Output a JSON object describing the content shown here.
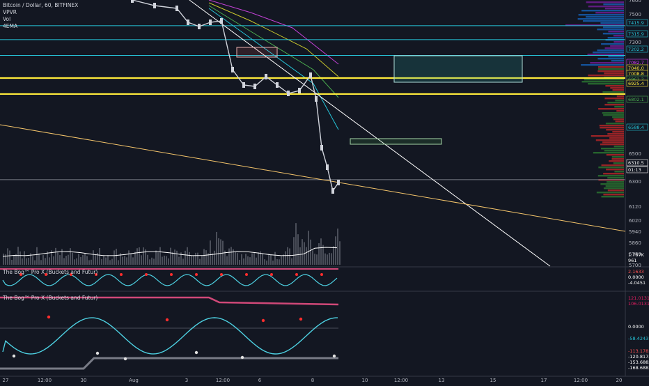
{
  "legend": {
    "symbol": "Bitcoin / Dollar, 60, BITFINEX",
    "ind1": "VPVR",
    "ind2": "Vol",
    "ind3": "4EMA"
  },
  "osc1": {
    "label": "The Bog™ Pro X (Buckets and Futur)"
  },
  "osc2": {
    "label": "The Bog™ Pro X (Buckets and Futur)"
  },
  "colors": {
    "background": "#131722",
    "candle": "#d1d4dc",
    "yellow_level": "#ffeb3b",
    "cyan_level": "#26c6da",
    "trendline": "#ffffff",
    "support_trend": "#f5c56b",
    "ema_magenta": "#c341d6",
    "ema_yellow": "#c8c62c",
    "ema_green": "#4caf50",
    "ema_cyan": "#26c6da",
    "osc_wave": "#4dd0e1",
    "osc_dot_red": "#ff2d2d",
    "osc_dot_white": "#e0e0e0",
    "osc_bar": "#d04878"
  },
  "chart_data": {
    "type": "candlestick",
    "symbol": "Bitcoin / Dollar",
    "timeframe": "60",
    "exchange": "BITFINEX",
    "y_range": [
      5700,
      7600
    ],
    "y_ticks": [
      7600,
      7500,
      7300,
      7100,
      6900,
      6700,
      6500,
      6300,
      6120,
      6020,
      5940,
      5860,
      5780,
      5700
    ],
    "x_ticks": [
      "27",
      "12:00",
      "30",
      "Aug",
      "3",
      "12:00",
      "6",
      "8",
      "10",
      "12:00",
      "13",
      "15",
      "17",
      "12:00",
      "20"
    ],
    "price_series": [
      {
        "t": 0,
        "p": 7600
      },
      {
        "t": 4,
        "p": 7560
      },
      {
        "t": 8,
        "p": 7540
      },
      {
        "t": 10,
        "p": 7440
      },
      {
        "t": 12,
        "p": 7410
      },
      {
        "t": 14,
        "p": 7440
      },
      {
        "t": 16,
        "p": 7450
      },
      {
        "t": 18,
        "p": 7100
      },
      {
        "t": 20,
        "p": 6990
      },
      {
        "t": 22,
        "p": 6980
      },
      {
        "t": 24,
        "p": 7050
      },
      {
        "t": 26,
        "p": 6990
      },
      {
        "t": 28,
        "p": 6930
      },
      {
        "t": 30,
        "p": 6950
      },
      {
        "t": 32,
        "p": 7060
      },
      {
        "t": 33,
        "p": 6890
      },
      {
        "t": 34,
        "p": 6540
      },
      {
        "t": 35,
        "p": 6400
      },
      {
        "t": 36,
        "p": 6230
      },
      {
        "t": 37,
        "p": 6290
      }
    ],
    "horizontal_levels": [
      {
        "price": 7415.9,
        "color": "#26c6da"
      },
      {
        "price": 7315.9,
        "color": "#26c6da"
      },
      {
        "price": 7202.2,
        "color": "#26c6da"
      },
      {
        "price": 7040.0,
        "color": "#ffeb3b"
      },
      {
        "price": 6925.4,
        "color": "#ffeb3b"
      },
      {
        "price": 6310.5,
        "color": "#787b86"
      }
    ],
    "price_labels": [
      {
        "value": "7415.9",
        "color": "#26c6da"
      },
      {
        "value": "7315.9",
        "color": "#26c6da"
      },
      {
        "value": "7202.2",
        "color": "#26c6da"
      },
      {
        "value": "7082.7",
        "color": "#e040fb"
      },
      {
        "value": "7040.0",
        "color": "#ffeb3b"
      },
      {
        "value": "7008.8",
        "color": "#ffeb3b"
      },
      {
        "value": "6962.2",
        "color": "#4caf50"
      },
      {
        "value": "6925.4",
        "color": "#ffeb3b"
      },
      {
        "value": "6802.1",
        "color": "#4caf50"
      },
      {
        "value": "6588.4",
        "color": "#26c6da"
      },
      {
        "value": "6310.5",
        "color": "#ffffff"
      },
      {
        "value": "01:13",
        "color": "#ffffff"
      }
    ],
    "volume_labels": [
      "1.757K",
      "961"
    ],
    "osc1_labels": [
      {
        "value": "2.1633",
        "color": "#ff5252"
      },
      {
        "value": "0.0000",
        "color": "#ffffff"
      },
      {
        "value": "-4.0451",
        "color": "#ffffff"
      }
    ],
    "osc2_labels": [
      {
        "value": "121.0131",
        "color": "#e91e63"
      },
      {
        "value": "106.0131",
        "color": "#e91e63"
      },
      {
        "value": "0.0000",
        "color": "#ffffff"
      },
      {
        "value": "-58.4243",
        "color": "#26c6da"
      },
      {
        "value": "-113.1785",
        "color": "#ff5252"
      },
      {
        "value": "-120.8174",
        "color": "#ffffff"
      },
      {
        "value": "-153.6883",
        "color": "#ffffff"
      },
      {
        "value": "-168.6883",
        "color": "#ffffff"
      }
    ]
  }
}
